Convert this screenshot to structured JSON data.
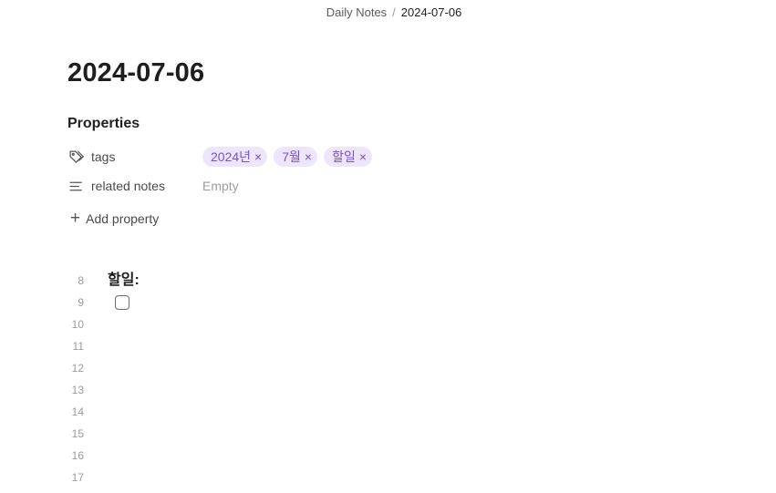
{
  "breadcrumb": {
    "folder": "Daily Notes",
    "separator": "/",
    "current": "2024-07-06"
  },
  "note": {
    "title": "2024-07-06"
  },
  "properties": {
    "heading": "Properties",
    "tags": {
      "key": "tags",
      "icon": "tag-icon",
      "values": [
        "2024년",
        "7월",
        "할일"
      ],
      "remove_glyph": "×"
    },
    "related_notes": {
      "key": "related notes",
      "icon": "text-lines-icon",
      "value": "Empty"
    },
    "add_property": {
      "label": "Add property",
      "icon": "plus-icon"
    }
  },
  "editor": {
    "line_numbers": [
      "8",
      "9",
      "10",
      "11",
      "12",
      "13",
      "14",
      "15",
      "16",
      "17"
    ],
    "heading_text": "할일:",
    "task_checked": false
  },
  "colors": {
    "tag_background": "#ede6fb",
    "tag_text": "#7a4fd6",
    "muted_text": "#9d9d9d"
  }
}
